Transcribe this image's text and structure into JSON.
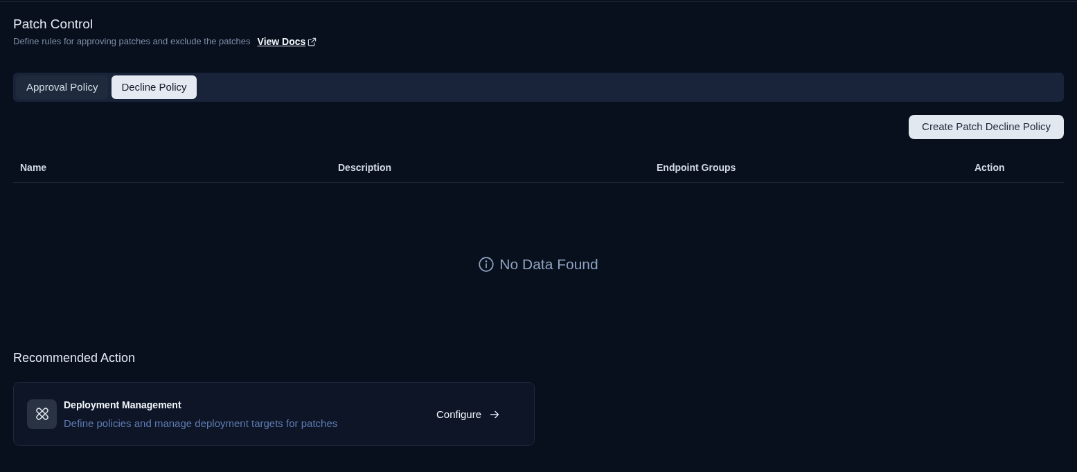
{
  "page": {
    "title": "Patch Control",
    "subtitle": "Define rules for approving patches and exclude the patches",
    "docs_link": "View Docs"
  },
  "tabs": [
    {
      "label": "Approval Policy",
      "selected": false
    },
    {
      "label": "Decline Policy",
      "selected": true
    }
  ],
  "create_button": "Create Patch Decline Policy",
  "table": {
    "columns": [
      "Name",
      "Description",
      "Endpoint Groups",
      "Action"
    ],
    "empty_message": "No Data Found"
  },
  "recommended": {
    "heading": "Recommended Action",
    "cards": [
      {
        "title": "Deployment Management",
        "description": "Define policies and manage deployment targets for patches",
        "action": "Configure"
      }
    ]
  }
}
